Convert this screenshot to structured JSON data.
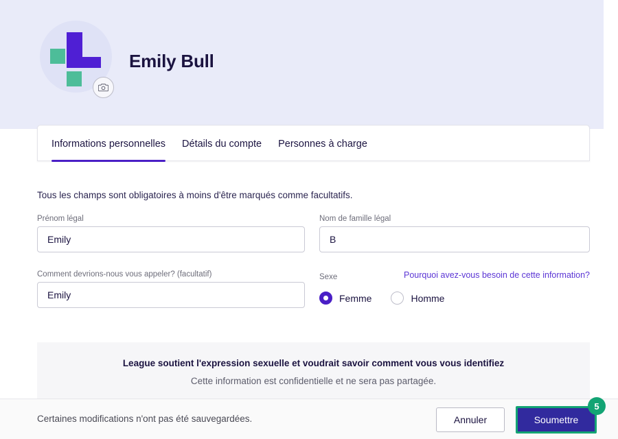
{
  "header": {
    "profile_name": "Emily Bull",
    "avatar_icon": "league-logo",
    "camera_icon": "camera-icon",
    "band_color": "#e9ebf9",
    "logo_purple": "#4f1fd4",
    "logo_green": "#4dbd99"
  },
  "tabs": [
    {
      "label": "Informations personnelles",
      "active": true
    },
    {
      "label": "Détails du compte",
      "active": false
    },
    {
      "label": "Personnes à charge",
      "active": false
    }
  ],
  "form": {
    "intro": "Tous les champs sont obligatoires à moins d'être marqués comme facultatifs.",
    "first_name": {
      "label": "Prénom légal",
      "value": "Emily",
      "placeholder": ""
    },
    "last_name": {
      "label": "Nom de famille légal",
      "value": "B",
      "placeholder": ""
    },
    "preferred_name": {
      "label": "Comment devrions-nous vous appeler? (facultatif)",
      "value": "Emily",
      "placeholder": ""
    },
    "sex": {
      "label": "Sexe",
      "why_link": "Pourquoi avez-vous besoin de cette information?",
      "options": [
        {
          "label": "Femme",
          "checked": true
        },
        {
          "label": "Homme",
          "checked": false
        }
      ]
    }
  },
  "info_banner": {
    "title": "League soutient l'expression sexuelle et voudrait savoir comment vous vous identifiez",
    "subtitle": "Cette information est confidentielle et ne sera pas partagée.",
    "background": "#f6f6f8"
  },
  "bottom_bar": {
    "unsaved_message": "Certaines modifications n'ont pas été sauvegardées.",
    "cancel_label": "Annuler",
    "submit_label": "Soumettre",
    "submit_badge": "5",
    "highlight_color": "#13a474",
    "submit_color": "#312a9e"
  }
}
